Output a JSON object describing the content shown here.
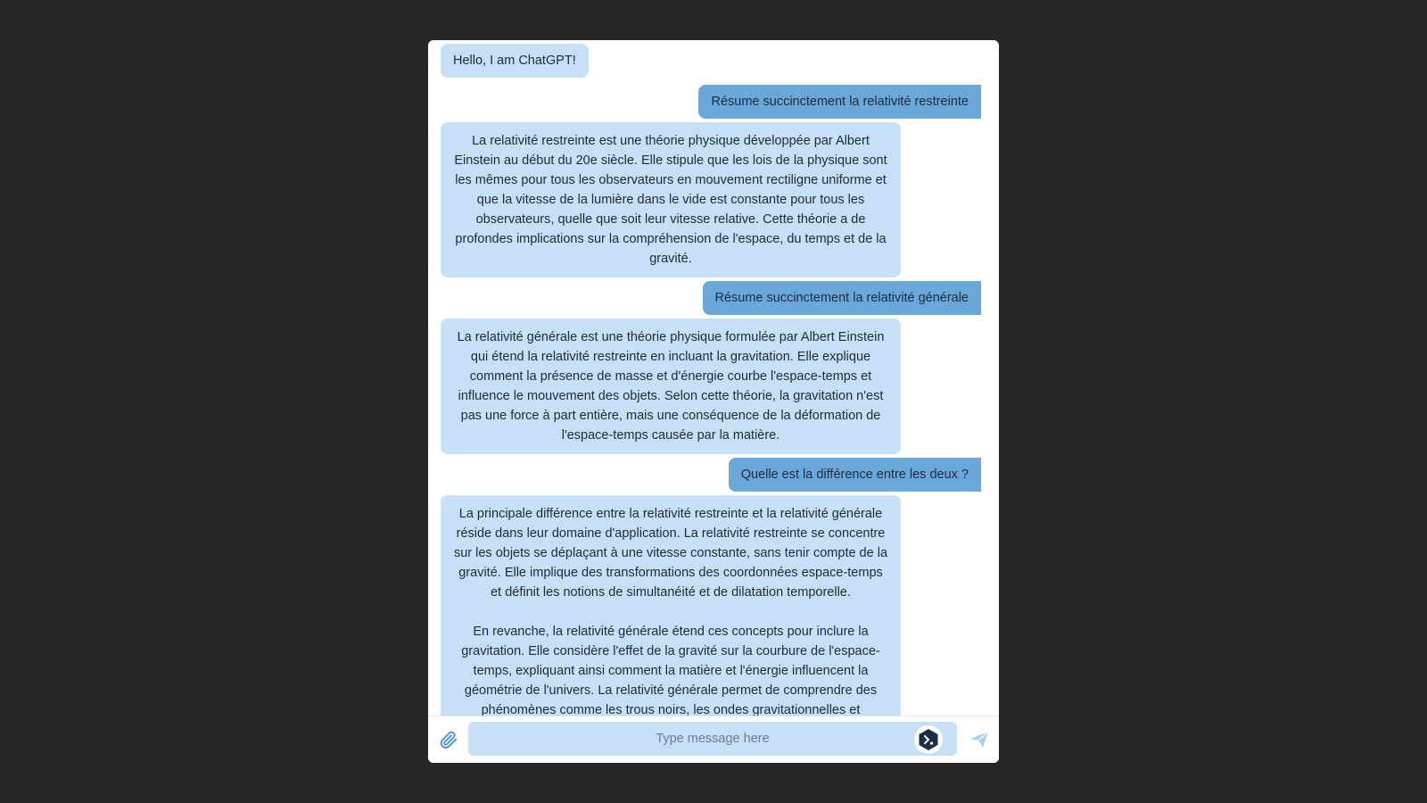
{
  "messages": [
    {
      "role": "bot",
      "text": "Hello, I am ChatGPT!"
    },
    {
      "role": "user",
      "text": "Résume succinctement la relativité restreinte"
    },
    {
      "role": "bot",
      "text": "La relativité restreinte est une théorie physique développée par Albert Einstein au début du 20e siècle. Elle stipule que les lois de la physique sont les mêmes pour tous les observateurs en mouvement rectiligne uniforme et que la vitesse de la lumière dans le vide est constante pour tous les observateurs, quelle que soit leur vitesse relative. Cette théorie a de profondes implications sur la compréhension de l'espace, du temps et de la gravité."
    },
    {
      "role": "user",
      "text": "Résume succinctement la relativité générale"
    },
    {
      "role": "bot",
      "text": "La relativité générale est une théorie physique formulée par Albert Einstein qui étend la relativité restreinte en incluant la gravitation. Elle explique comment la présence de masse et d'énergie courbe l'espace-temps et influence le mouvement des objets. Selon cette théorie, la gravitation n'est pas une force à part entière, mais une conséquence de la déformation de l'espace-temps causée par la matière."
    },
    {
      "role": "user",
      "text": "Quelle est la différence entre les deux ?"
    },
    {
      "role": "bot",
      "text": "La principale différence entre la relativité restreinte et la relativité générale réside dans leur domaine d'application. La relativité restreinte se concentre sur les objets se déplaçant à une vitesse constante, sans tenir compte de la gravité. Elle implique des transformations des coordonnées espace-temps et définit les notions de simultanéité et de dilatation temporelle.\n\nEn revanche, la relativité générale étend ces concepts pour inclure la gravitation. Elle considère l'effet de la gravité sur la courbure de l'espace-temps, expliquant ainsi comment la matière et l'énergie influencent la géométrie de l'univers. La relativité générale permet de comprendre des phénomènes comme les trous noirs, les ondes gravitationnelles et l'expansion de l'univers."
    }
  ],
  "composer": {
    "placeholder": "Type message here",
    "attach_icon": "paperclip-icon",
    "send_icon": "send-icon",
    "extension_icon": "extension-badge-icon"
  },
  "colors": {
    "background": "#262626",
    "bot_bubble": "#c5e0f7",
    "user_bubble": "#6aa8dc",
    "input_bg": "#c5e0f7"
  }
}
